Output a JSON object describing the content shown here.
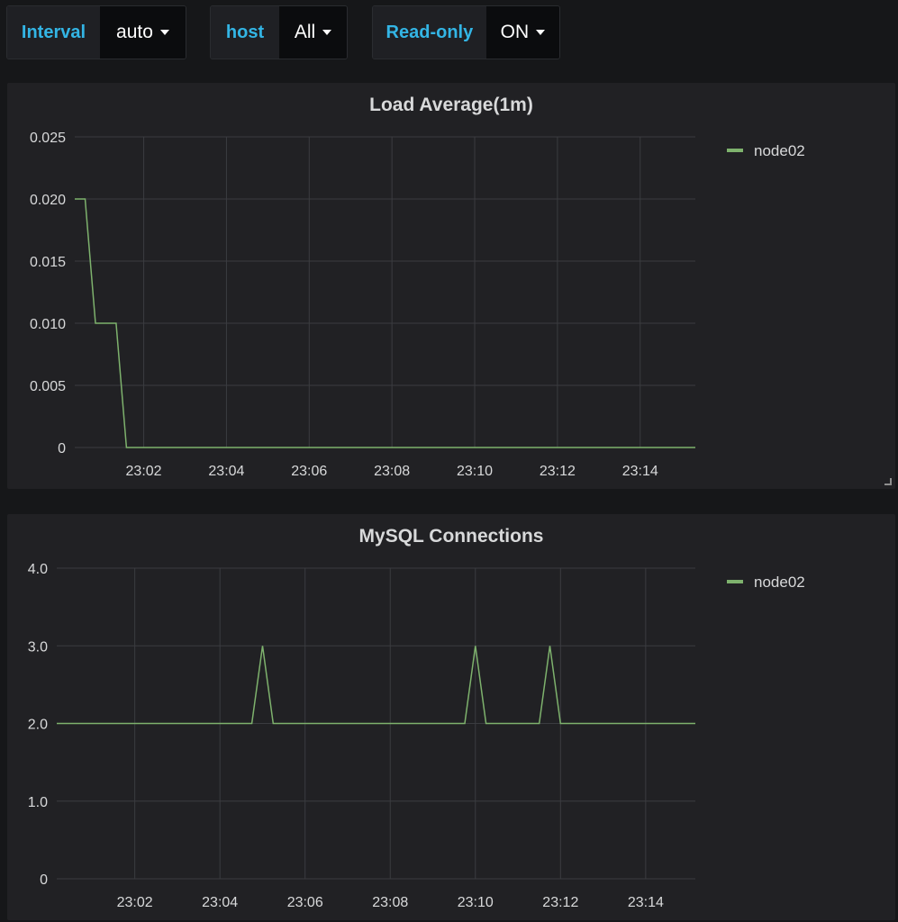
{
  "variables": [
    {
      "label": "Interval",
      "value": "auto"
    },
    {
      "label": "host",
      "value": "All"
    },
    {
      "label": "Read-only",
      "value": "ON"
    }
  ],
  "colors": {
    "background": "#161719",
    "panel": "#212124",
    "variable_label": "#33b5e5",
    "series": "#7eb26d",
    "grid": "#3b3c40"
  },
  "panels": [
    {
      "title": "Load Average(1m)",
      "legend": [
        "node02"
      ],
      "chart_data": {
        "type": "line",
        "title": "Load Average(1m)",
        "x_ticks": [
          "23:02",
          "23:04",
          "23:06",
          "23:08",
          "23:10",
          "23:12",
          "23:14"
        ],
        "y_ticks": [
          "0",
          "0.005",
          "0.010",
          "0.015",
          "0.020",
          "0.025"
        ],
        "ylim": [
          0,
          0.025
        ],
        "xlim_minutes": [
          "23:00:20",
          "23:15:20"
        ],
        "grid": true,
        "legend_position": "right",
        "series": [
          {
            "name": "node02",
            "color": "#7eb26d",
            "points": [
              [
                "23:00:20",
                0.02
              ],
              [
                "23:00:35",
                0.02
              ],
              [
                "23:00:50",
                0.01
              ],
              [
                "23:01:20",
                0.01
              ],
              [
                "23:01:35",
                0
              ],
              [
                "23:15:20",
                0
              ]
            ]
          }
        ]
      }
    },
    {
      "title": "MySQL Connections",
      "legend": [
        "node02"
      ],
      "chart_data": {
        "type": "line",
        "title": "MySQL Connections",
        "x_ticks": [
          "23:02",
          "23:04",
          "23:06",
          "23:08",
          "23:10",
          "23:12",
          "23:14"
        ],
        "y_ticks": [
          "0",
          "1.0",
          "2.0",
          "3.0",
          "4.0"
        ],
        "ylim": [
          0,
          4
        ],
        "xlim_minutes": [
          "23:00:10",
          "23:15:10"
        ],
        "grid": true,
        "legend_position": "right",
        "series": [
          {
            "name": "node02",
            "color": "#7eb26d",
            "points": [
              [
                "23:00:10",
                2
              ],
              [
                "23:04:45",
                2
              ],
              [
                "23:05:00",
                3
              ],
              [
                "23:05:15",
                2
              ],
              [
                "23:09:45",
                2
              ],
              [
                "23:10:00",
                3
              ],
              [
                "23:10:15",
                2
              ],
              [
                "23:11:30",
                2
              ],
              [
                "23:11:45",
                3
              ],
              [
                "23:12:00",
                2
              ],
              [
                "23:15:10",
                2
              ]
            ]
          }
        ]
      }
    }
  ]
}
